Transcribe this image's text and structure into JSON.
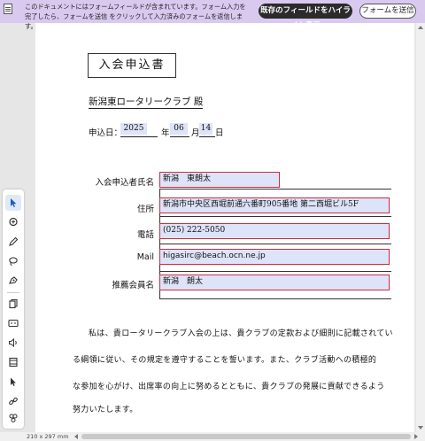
{
  "formbar": {
    "message": "このドキュメントにはフォームフィールドが含まれています。フォーム入力を完了したら、フォームを送信 をクリックして入力済みのフォームを返信します。",
    "highlight_label": "既存のフィールドをハイライト表示",
    "submit_label": "フォームを送信"
  },
  "tools": [
    "select-icon",
    "comment-icon",
    "pen-icon",
    "lasso-icon",
    "stamp-icon",
    "pages-icon",
    "caption-icon",
    "audio-icon",
    "film-icon",
    "cursor-icon",
    "link-icon",
    "group-icon",
    "more-icon"
  ],
  "document": {
    "title": "入会申込書",
    "addressee": "新潟東ロータリークラブ 殿",
    "date": {
      "label": "申込日：",
      "year": "2025",
      "year_unit": "年",
      "month": "06",
      "month_unit": "月",
      "day": "14",
      "day_unit": "日"
    },
    "fields": [
      {
        "label": "入会申込者氏名",
        "value": "新潟　東朗太"
      },
      {
        "label": "住所",
        "value": "新潟市中央区西堀前通六番町905番地 第二西堀ビル5F"
      },
      {
        "label": "電話",
        "value": "(025) 222-5050"
      },
      {
        "label": "Mail",
        "value": "higasirc@beach.ocn.ne.jp"
      },
      {
        "label": "推薦会員名",
        "value": "新潟　朗太"
      }
    ],
    "paragraph": [
      "私は、貴ロータリークラブ入会の上は、貴クラブの定款および細則に記載されてい",
      "る綱領に従い、その規定を遵守することを誓います。また、クラブ活動への積極的",
      "な参加を心がけ、出席率の向上に努めるとともに、貴クラブの発展に貢献できるよう",
      "努力いたします。"
    ]
  },
  "status": {
    "page_size": "210 x 297 mm"
  },
  "colors": {
    "formbar_bg": "#d9c9ef",
    "field_fill": "#dde3f8",
    "field_border": "#d12a3a",
    "active_tool": "#1a5fc7"
  }
}
